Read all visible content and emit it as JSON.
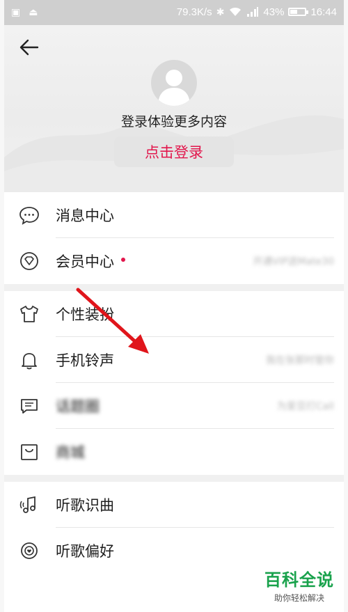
{
  "status_bar": {
    "speed": "79.3K/s",
    "battery_pct": "43%",
    "battery_level": 0.43,
    "time": "16:44"
  },
  "header": {
    "prompt": "登录体验更多内容",
    "login_label": "点击登录"
  },
  "sections": [
    {
      "items": [
        {
          "label": "消息中心",
          "right": ""
        },
        {
          "label": "会员中心",
          "right": "开通VIP送Mate30",
          "badge": true
        }
      ]
    },
    {
      "items": [
        {
          "label": "个性装扮",
          "right": ""
        },
        {
          "label": "手机铃声",
          "right": "我在张那时管你"
        },
        {
          "label": "话题圈",
          "right": "为爱豆打Call",
          "blurred": true
        },
        {
          "label": "商城",
          "right": "",
          "blurred": true
        }
      ]
    },
    {
      "items": [
        {
          "label": "听歌识曲",
          "right": ""
        },
        {
          "label": "听歌偏好",
          "right": ""
        }
      ]
    }
  ],
  "watermark": {
    "title": "百科全说",
    "subtitle": "助你轻松解决"
  },
  "colors": {
    "accent": "#e2164c",
    "watermark": "#19a24c"
  }
}
